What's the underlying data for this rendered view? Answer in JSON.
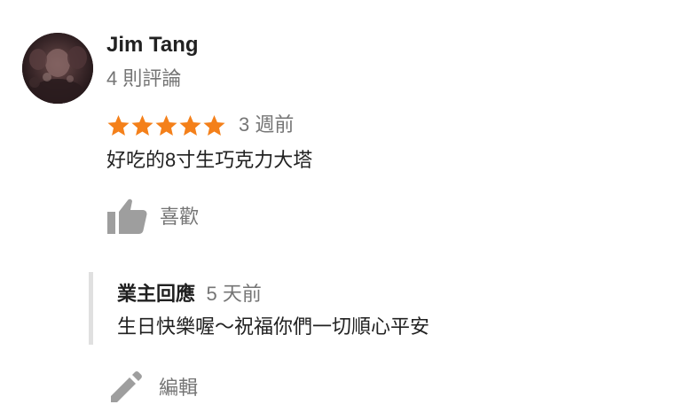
{
  "reviewer": {
    "name": "Jim Tang",
    "review_count": "4 則評論",
    "avatar_icon": "profile-photo"
  },
  "review": {
    "rating": 5,
    "max_rating": 5,
    "star_color": "#f4801a",
    "time": "3 週前",
    "text": "好吃的8寸生巧克力大塔"
  },
  "actions": {
    "like_label": "喜歡",
    "like_icon": "thumbs-up-icon",
    "edit_label": "編輯",
    "edit_icon": "pencil-icon"
  },
  "owner_reply": {
    "label": "業主回應",
    "time": "5 天前",
    "text": "生日快樂喔～祝福你們一切順心平安"
  }
}
